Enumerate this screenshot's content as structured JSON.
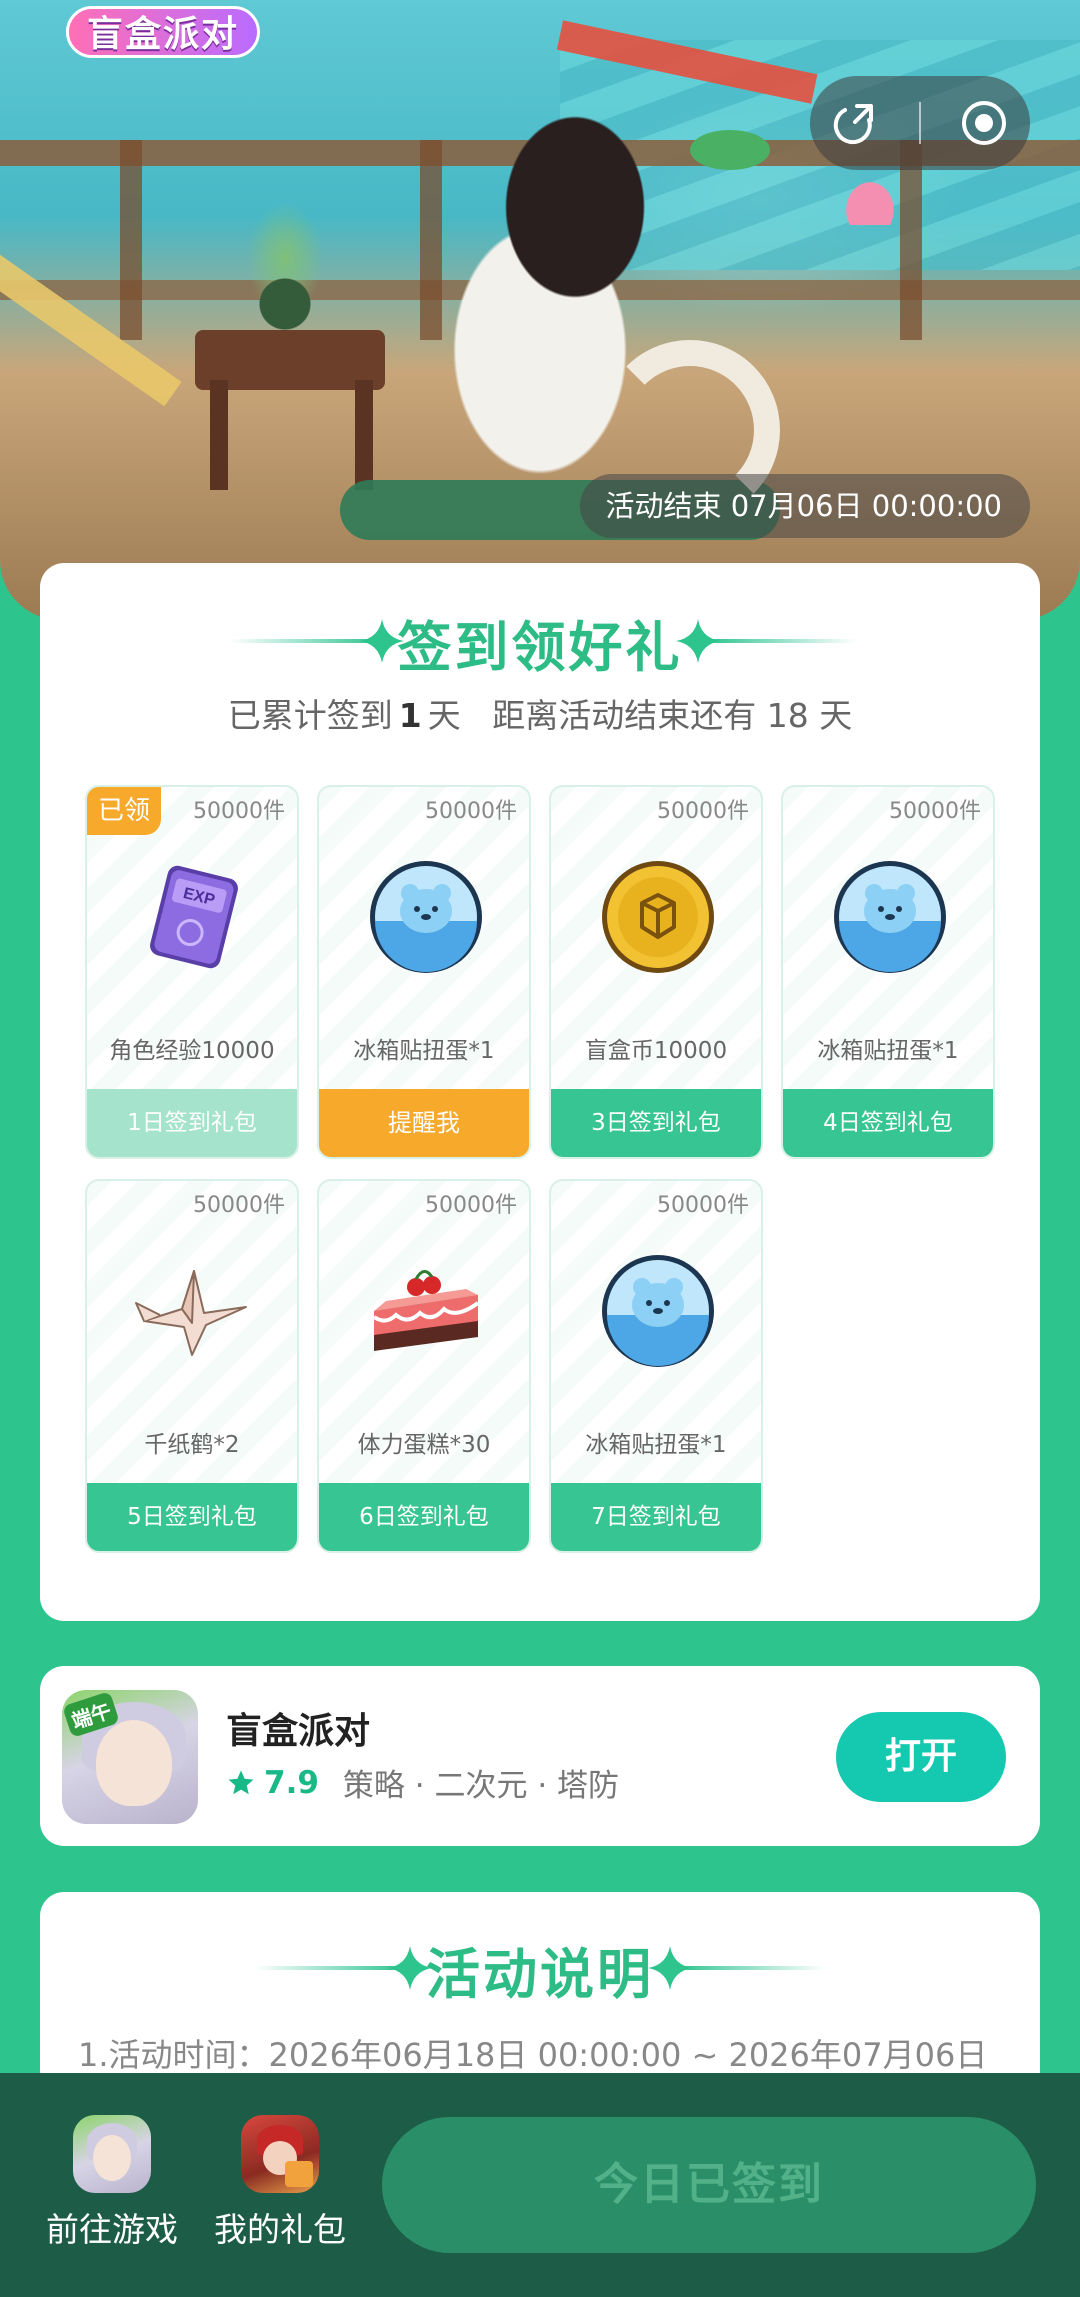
{
  "banner": {
    "logo_text": "盲盒派对",
    "end_time": "活动结束 07月06日 00:00:00"
  },
  "signin": {
    "title": "签到领好礼",
    "progress_prefix": "已累计签到",
    "progress_days": "1",
    "progress_suffix": "天",
    "remaining_text": "距离活动结束还有 18 天",
    "items": [
      {
        "qty": "50000件",
        "name": "角色经验10000",
        "button": "1日签到礼包",
        "claimed_label": "已领",
        "state": "claimed",
        "icon": "exp-card-icon"
      },
      {
        "qty": "50000件",
        "name": "冰箱贴扭蛋*1",
        "button": "提醒我",
        "state": "remind",
        "icon": "bear-capsule-icon"
      },
      {
        "qty": "50000件",
        "name": "盲盒币10000",
        "button": "3日签到礼包",
        "state": "pending",
        "icon": "gold-coin-icon"
      },
      {
        "qty": "50000件",
        "name": "冰箱贴扭蛋*1",
        "button": "4日签到礼包",
        "state": "pending",
        "icon": "bear-capsule-icon"
      },
      {
        "qty": "50000件",
        "name": "千纸鹤*2",
        "button": "5日签到礼包",
        "state": "pending",
        "icon": "paper-crane-icon"
      },
      {
        "qty": "50000件",
        "name": "体力蛋糕*30",
        "button": "6日签到礼包",
        "state": "pending",
        "icon": "cake-icon"
      },
      {
        "qty": "50000件",
        "name": "冰箱贴扭蛋*1",
        "button": "7日签到礼包",
        "state": "pending",
        "icon": "bear-capsule-icon"
      }
    ]
  },
  "app": {
    "name": "盲盒派对",
    "rating": "7.9",
    "tags": "策略 · 二次元 · 塔防",
    "open_label": "打开",
    "icon_tag": "端午"
  },
  "rules": {
    "title": "活动说明",
    "line1": "1.活动时间：2026年06月18日 00:00:00 ~ 2026年07月06日"
  },
  "bottom": {
    "game_label": "前往游戏",
    "gift_label": "我的礼包",
    "signed_label": "今日已签到"
  },
  "colors": {
    "primary": "#2ec48e",
    "accent_orange": "#f7a92c",
    "open_button": "#15c9b0",
    "bottom_bar": "#1d5d48"
  }
}
